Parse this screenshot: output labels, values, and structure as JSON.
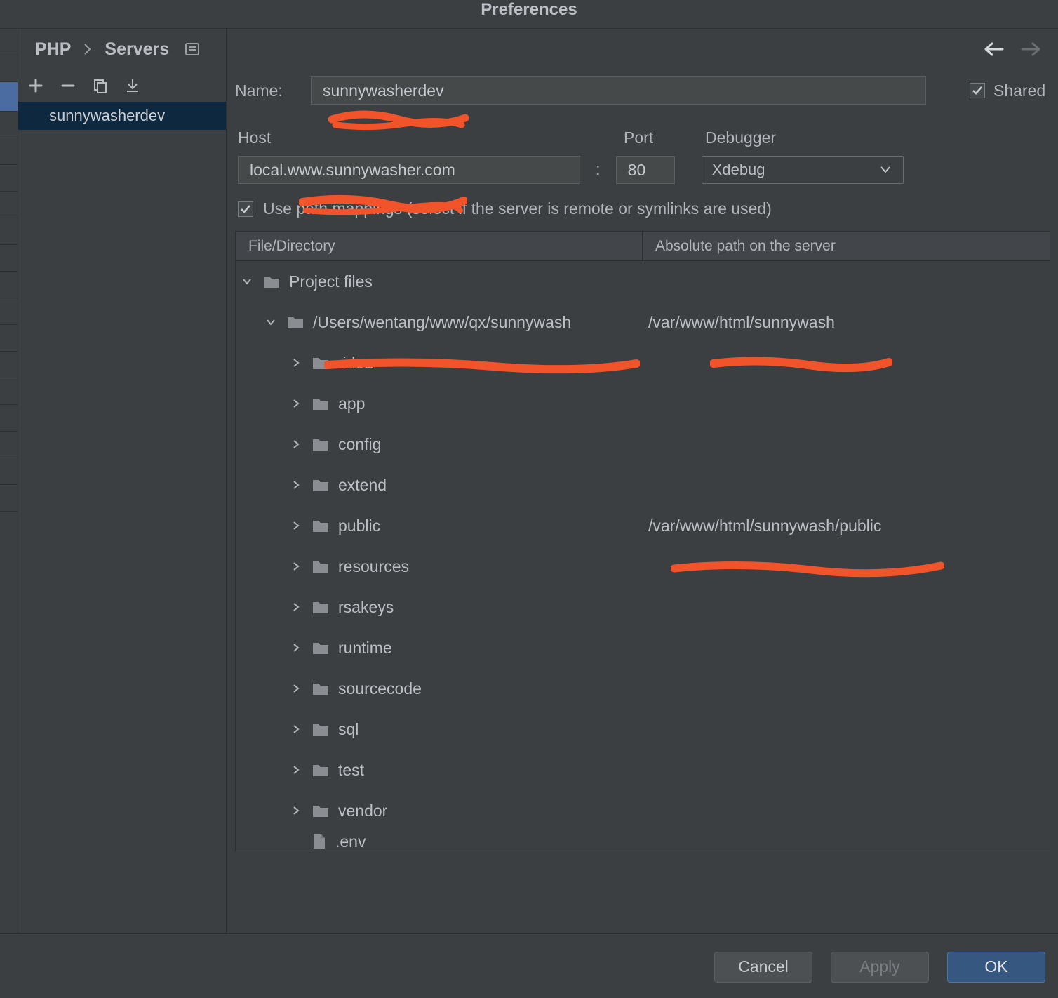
{
  "window": {
    "title": "Preferences"
  },
  "breadcrumb": {
    "a": "PHP",
    "b": "Servers"
  },
  "nav": {
    "back_enabled": true,
    "forward_enabled": false
  },
  "left": {
    "servers": [
      {
        "name": "sunnywasherdev",
        "selected": true
      }
    ]
  },
  "form": {
    "name_label": "Name:",
    "name_value": "sunnywasherdev",
    "shared_label": "Shared",
    "shared_checked": true,
    "host_label": "Host",
    "host_value": "local.www.sunnywasher.com",
    "port_label": "Port",
    "port_value": "80",
    "debugger_label": "Debugger",
    "debugger_value": "Xdebug",
    "use_path_mappings_label": "Use path mappings (select if the server is remote or symlinks are used)",
    "use_path_mappings_checked": true
  },
  "mapping": {
    "header_left": "File/Directory",
    "header_right": "Absolute path on the server",
    "root_label": "Project files",
    "project_path": "/Users/wentang/www/qx/sunnywash",
    "project_server_path": "/var/www/html/sunnywash",
    "children": [
      {
        "name": ".idea"
      },
      {
        "name": "app"
      },
      {
        "name": "config"
      },
      {
        "name": "extend"
      },
      {
        "name": "public",
        "server_path": "/var/www/html/sunnywash/public"
      },
      {
        "name": "resources"
      },
      {
        "name": "rsakeys"
      },
      {
        "name": "runtime"
      },
      {
        "name": "sourcecode"
      },
      {
        "name": "sql"
      },
      {
        "name": "test"
      },
      {
        "name": "vendor"
      }
    ],
    "file_peek": ".env"
  },
  "buttons": {
    "cancel": "Cancel",
    "apply": "Apply",
    "ok": "OK"
  },
  "colors": {
    "redact": "#f1532a"
  }
}
